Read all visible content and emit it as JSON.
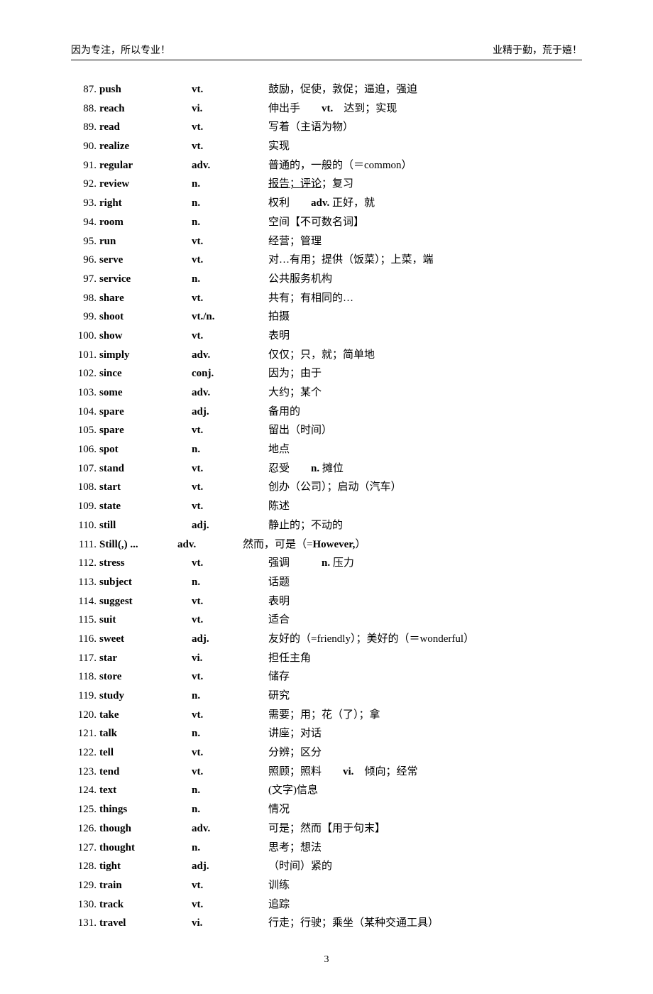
{
  "header": {
    "left": "因为专注，所以专业！",
    "right": "业精于勤，荒于嬉！"
  },
  "entries": [
    {
      "num": "87.",
      "word": "push",
      "pos": "vt.",
      "def_html": "鼓励，促使，敦促；逼迫，强迫"
    },
    {
      "num": "88.",
      "word": "reach",
      "pos": "vi.",
      "def_html": "伸出手　　<span class='b'>vt.</span>　达到；实现"
    },
    {
      "num": "89.",
      "word": "read",
      "pos": "vt.",
      "def_html": "写着（主语为物）"
    },
    {
      "num": "90.",
      "word": "realize",
      "pos": "vt.",
      "def_html": "实现"
    },
    {
      "num": "91.",
      "word": "regular",
      "pos": "adv.",
      "def_html": "普通的，一般的（＝common）"
    },
    {
      "num": "92.",
      "word": "review",
      "pos": "n.",
      "def_html": "<span class='u'>报告；评论</span>；复习"
    },
    {
      "num": "93.",
      "word": "right",
      "pos": "n.",
      "def_html": "权利　　<span class='b'>adv.</span> 正好，就"
    },
    {
      "num": "94.",
      "word": "room",
      "pos": "n.",
      "def_html": "空间【不可数名词】"
    },
    {
      "num": "95.",
      "word": "run",
      "pos": "vt.",
      "def_html": "经营；管理"
    },
    {
      "num": "96.",
      "word": "serve",
      "pos": "vt.",
      "def_html": "对…有用；提供（饭菜）；上菜，端"
    },
    {
      "num": "97.",
      "word": "service",
      "pos": "n.",
      "def_html": "公共服务机构"
    },
    {
      "num": "98.",
      "word": "share",
      "pos": "vt.",
      "def_html": "共有；有相同的…"
    },
    {
      "num": "99.",
      "word": "shoot",
      "pos": "vt./n.",
      "def_html": "拍摄"
    },
    {
      "num": "100.",
      "word": "show",
      "pos": "vt.",
      "def_html": "表明"
    },
    {
      "num": "101.",
      "word": "simply",
      "pos": "adv.",
      "def_html": "仅仅；只，就；简单地"
    },
    {
      "num": "102.",
      "word": "since",
      "pos": "conj.",
      "def_html": "因为；由于"
    },
    {
      "num": "103.",
      "word": "some",
      "pos": "adv.",
      "def_html": "大约；某个"
    },
    {
      "num": "104.",
      "word": "spare",
      "pos": "adj.",
      "def_html": "备用的"
    },
    {
      "num": "105.",
      "word": "spare",
      "pos": "vt.",
      "def_html": "留出（时间）"
    },
    {
      "num": "106.",
      "word": "spot",
      "pos": "n.",
      "def_html": "地点"
    },
    {
      "num": "107.",
      "word": "stand",
      "pos": "vt.",
      "def_html": "忍受　　<span class='b'>n.</span> 摊位"
    },
    {
      "num": "108.",
      "word": "start",
      "pos": "vt.",
      "def_html": "创办（公司）；启动（汽车）"
    },
    {
      "num": "109.",
      "word": "state",
      "pos": "vt.",
      "def_html": "陈述"
    },
    {
      "num": "110.",
      "word": "still",
      "pos": "adj.",
      "def_html": "静止的；不动的"
    },
    {
      "num": "111.",
      "word": "Still(,) ...",
      "pos": "adv.",
      "def_html": "然而，可是（=<span class='b'>However,</span>）",
      "special_indent": true
    },
    {
      "num": "112.",
      "word": "stress",
      "pos": "vt.",
      "def_html": "强调　　　<span class='b'>n.</span> 压力"
    },
    {
      "num": "113.",
      "word": "subject",
      "pos": "n.",
      "def_html": "话题"
    },
    {
      "num": "114.",
      "word": "suggest",
      "pos": "vt.",
      "def_html": "表明"
    },
    {
      "num": "115.",
      "word": "suit",
      "pos": "vt.",
      "def_html": "适合"
    },
    {
      "num": "116.",
      "word": "sweet",
      "pos": "adj.",
      "def_html": "友好的（=friendly）；美好的（＝wonderful）"
    },
    {
      "num": "117.",
      "word": "star",
      "pos": "vi.",
      "def_html": "担任主角"
    },
    {
      "num": "118.",
      "word": "store",
      "pos": "vt.",
      "def_html": "储存"
    },
    {
      "num": "119.",
      "word": "study",
      "pos": "n.",
      "def_html": "研究"
    },
    {
      "num": "120.",
      "word": "take",
      "pos": "vt.",
      "def_html": "需要；用；花（了）；拿"
    },
    {
      "num": "121.",
      "word": "talk",
      "pos": "n.",
      "def_html": "讲座；对话"
    },
    {
      "num": "122.",
      "word": "tell",
      "pos": "vt.",
      "def_html": "分辨；区分"
    },
    {
      "num": "123.",
      "word": "tend",
      "pos": "vt.",
      "def_html": "照顾；照料　　<span class='b'>vi.</span>　倾向；经常"
    },
    {
      "num": "124.",
      "word": "text",
      "pos": "n.",
      "def_html": "(文字)信息"
    },
    {
      "num": "125.",
      "word": "things",
      "pos": "n.",
      "def_html": "情况"
    },
    {
      "num": "126.",
      "word": "though",
      "pos": "adv.",
      "def_html": "可是；然而【用于句末】"
    },
    {
      "num": "127.",
      "word": "thought",
      "pos": "n.",
      "def_html": "思考；想法"
    },
    {
      "num": "128.",
      "word": "tight",
      "pos": "adj.",
      "def_html": "（时间）紧的"
    },
    {
      "num": "129.",
      "word": "train",
      "pos": "vt.",
      "def_html": "训练"
    },
    {
      "num": "130.",
      "word": "track",
      "pos": "vt.",
      "def_html": "追踪"
    },
    {
      "num": "131.",
      "word": "travel",
      "pos": "vi.",
      "def_html": "行走；行驶；乘坐（某种交通工具）"
    }
  ],
  "footer": {
    "page_number": "3"
  }
}
